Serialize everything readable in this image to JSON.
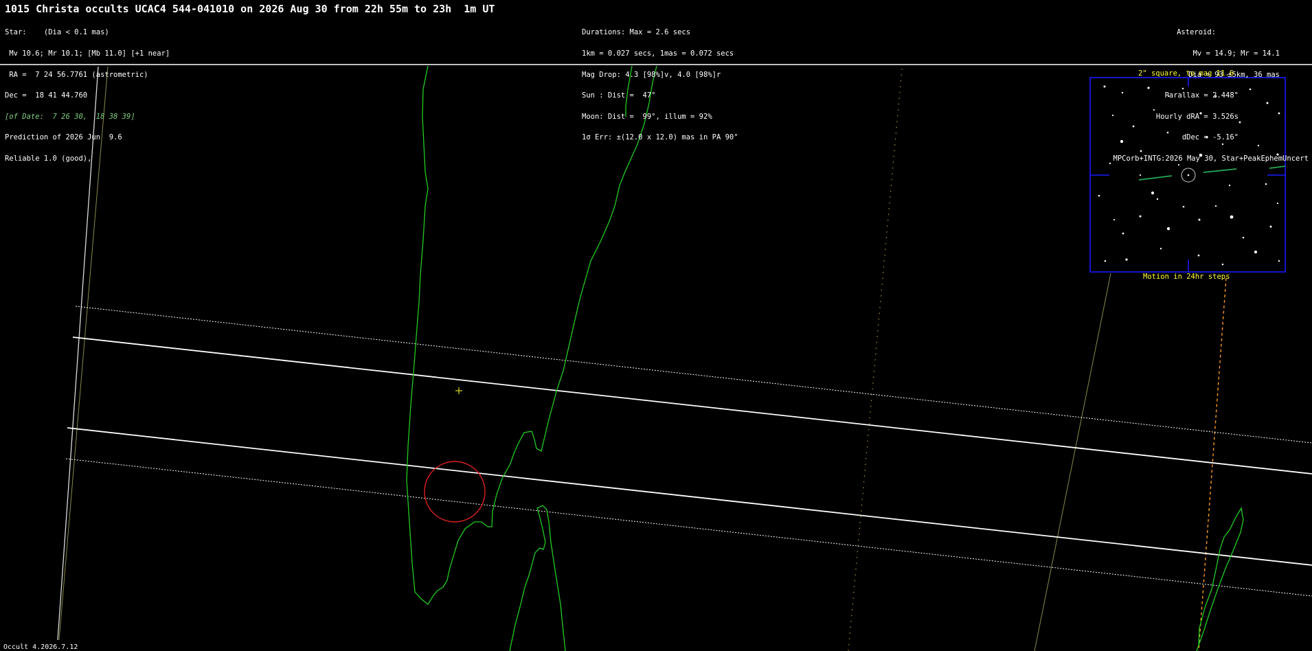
{
  "title": "1015 Christa occults UCAC4 544-041010 on 2026 Aug 30 from 22h 55m to 23h  1m UT",
  "star_block": {
    "lines": [
      "Star:    (Dia < 0.1 mas)",
      " Mv 10.6; Mr 10.1; [Mb 11.0] [+1 near]",
      " RA =  7 24 56.7761 (astrometric)",
      "Dec =  18 41 44.760",
      "[of Date:  7 26 30,  18 38 39]",
      "Prediction of 2026 Jun  9.6",
      "Reliable 1.0 (good),"
    ]
  },
  "event_block": {
    "lines": [
      "Durations: Max = 2.6 secs",
      "1km = 0.027 secs, 1mas = 0.072 secs",
      "Mag Drop: 4.3 [98%]v, 4.0 [98%]r",
      "Sun : Dist =  47°",
      "Moon: Dist =  99°, illum = 92%",
      "1σ Err: ±(12.0 x 12.0) mas in PA 90°"
    ]
  },
  "asteroid_block": {
    "lines": [
      "Asteroid:",
      "Mv = 14.9; Mr = 14.1",
      "Dia = 93 ±5km, 36 mas",
      "Parallax = 2.448\"",
      "Hourly dRA = 3.526s",
      "dDec = -5.16\"",
      "MPCorb+INTG:2026 May 30, Star+PeakEphemUncert"
    ]
  },
  "inset": {
    "top_caption": "2\" square, to mag 11.6",
    "bottom_caption": "Motion in 24hr steps"
  },
  "footer": "Occult 4.2026.7.12",
  "colors": {
    "background": "#000000",
    "path_lines": "#ffffff",
    "coastline": "#22cc22",
    "target_circle": "#dd2222",
    "center_mark": "#dddd22",
    "inset_frame": "#1a1aff",
    "caption": "#ffff33",
    "orange_track": "#ff9922"
  }
}
